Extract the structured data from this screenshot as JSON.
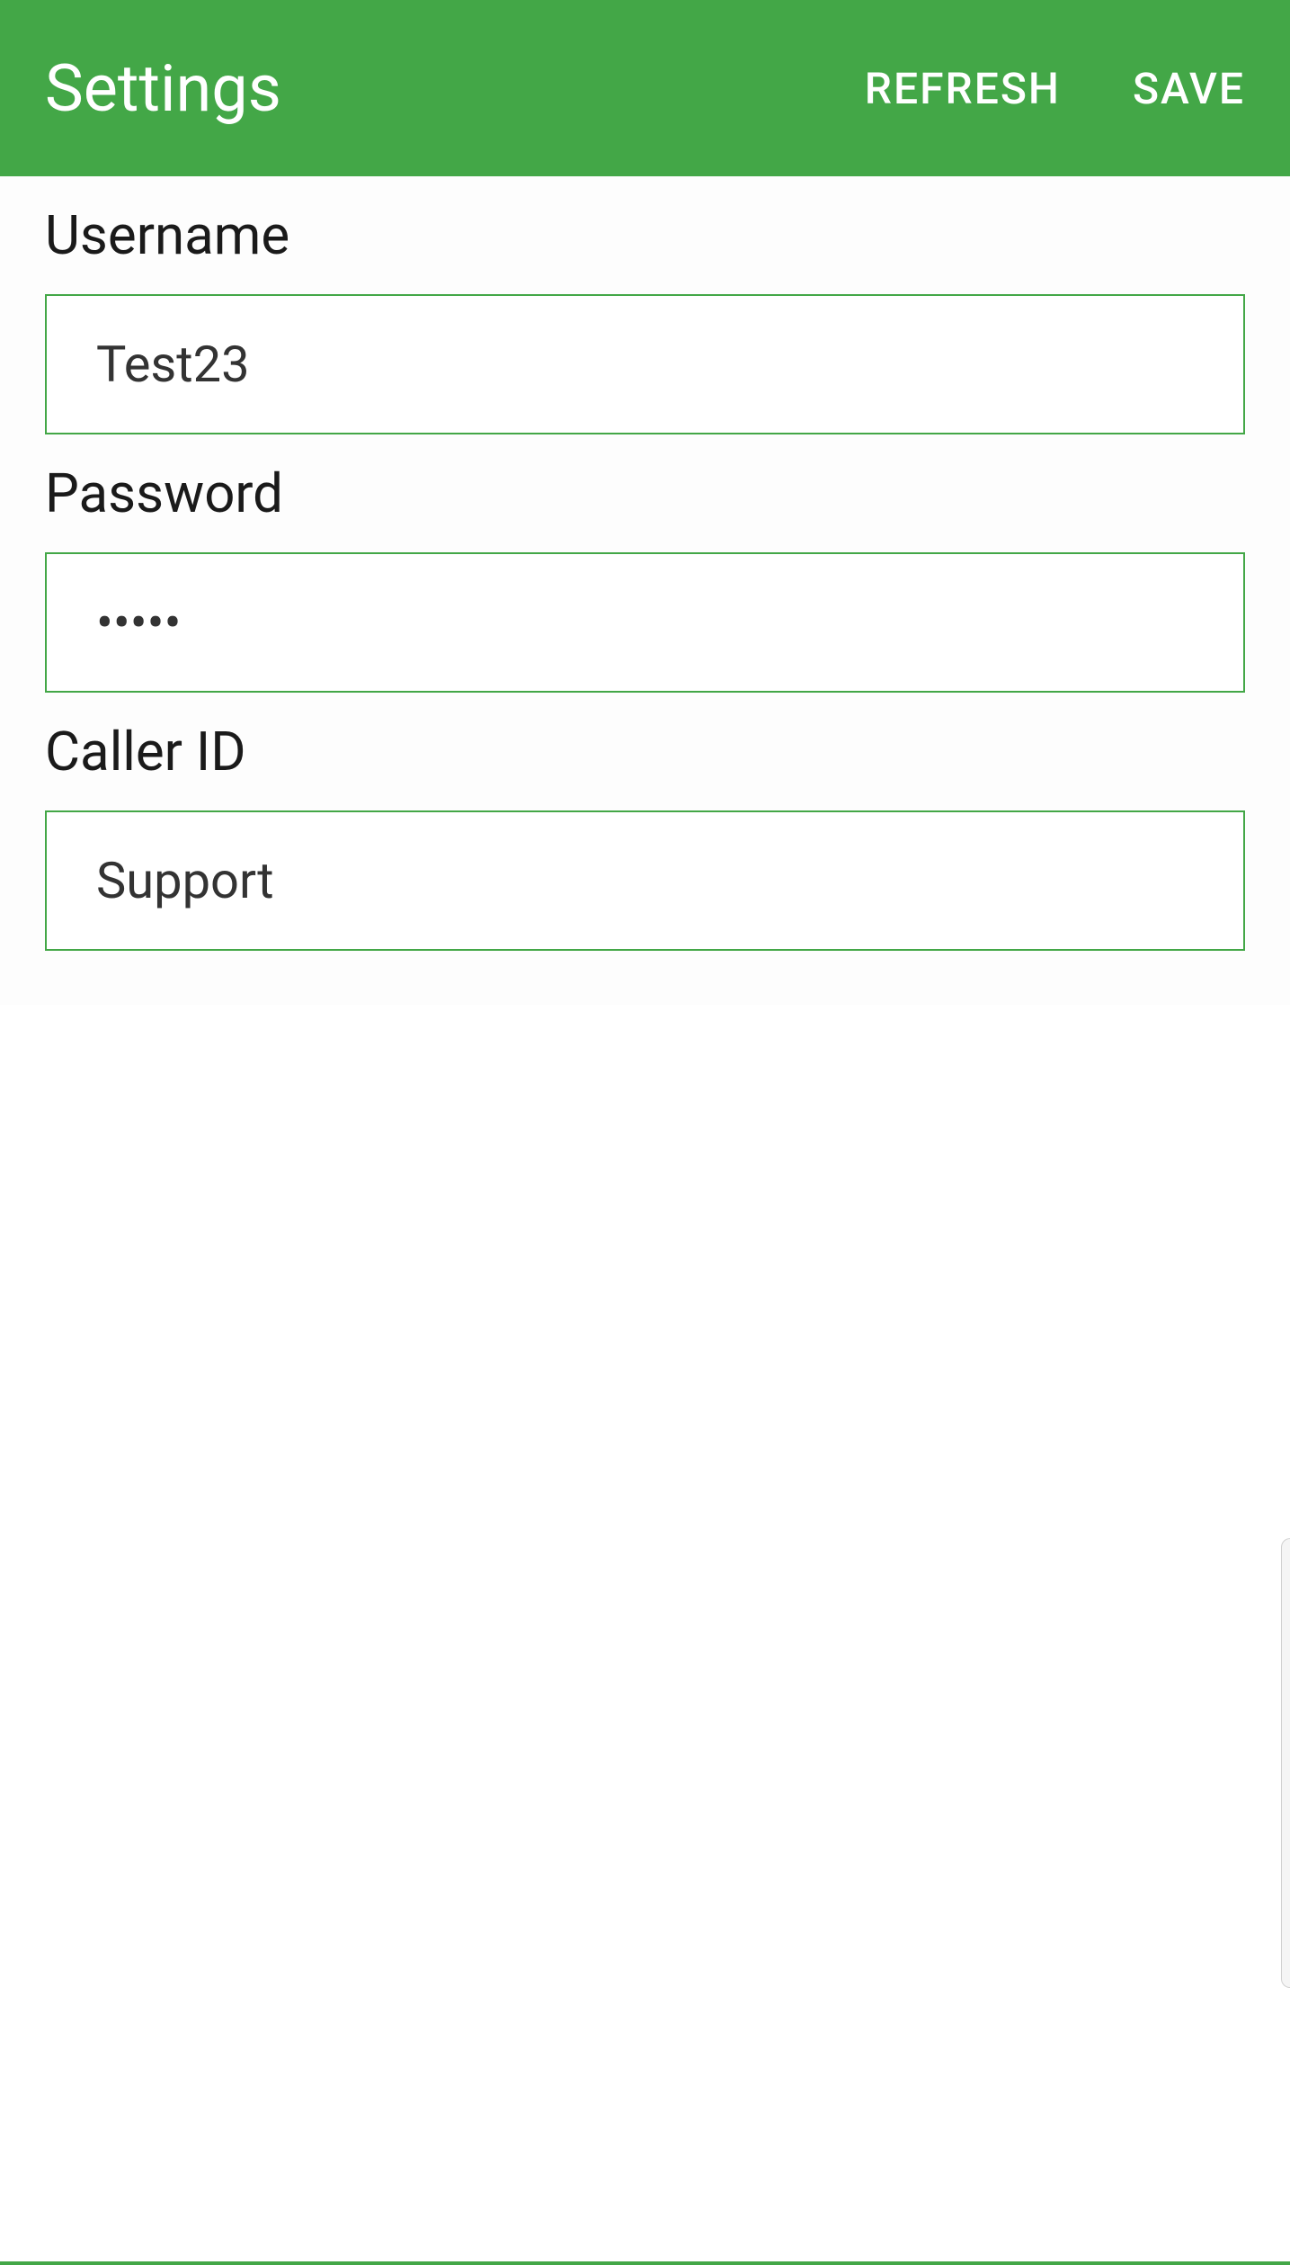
{
  "header": {
    "title": "Settings",
    "refresh_label": "REFRESH",
    "save_label": "SAVE"
  },
  "form": {
    "username": {
      "label": "Username",
      "value": "Test23"
    },
    "password": {
      "label": "Password",
      "value": "•••••"
    },
    "caller_id": {
      "label": "Caller ID",
      "value": "Support"
    }
  }
}
